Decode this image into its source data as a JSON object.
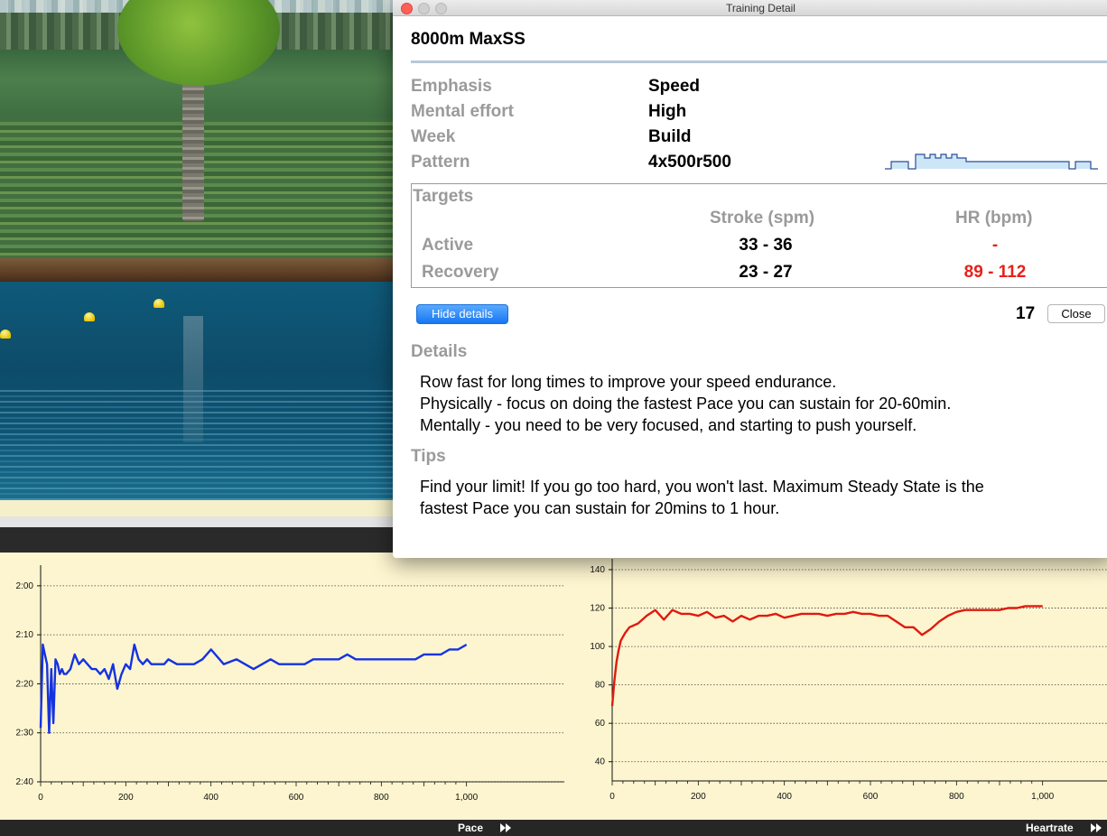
{
  "window": {
    "title": "Training Detail"
  },
  "workout": {
    "name": "8000m MaxSS",
    "info": [
      {
        "label": "Emphasis",
        "value": "Speed"
      },
      {
        "label": "Mental effort",
        "value": "High"
      },
      {
        "label": "Week",
        "value": "Build"
      },
      {
        "label": "Pattern",
        "value": "4x500r500"
      }
    ]
  },
  "targets": {
    "title": "Targets",
    "columns": [
      "Stroke (spm)",
      "HR (bpm)"
    ],
    "rows": [
      {
        "label": "Active",
        "stroke": "33 - 36",
        "hr": "-"
      },
      {
        "label": "Recovery",
        "stroke": "23 - 27",
        "hr": "89 - 112"
      }
    ],
    "hr_color": "#e8201a"
  },
  "controls": {
    "hide_details_label": "Hide details",
    "count": "17",
    "close_label": "Close"
  },
  "details": {
    "heading": "Details",
    "lines": [
      "Row fast for long times to improve your speed endurance.",
      "Physically - focus on doing the fastest Pace you can sustain for 20-60min.",
      "Mentally - you need to be very focused, and starting to push yourself."
    ]
  },
  "tips": {
    "heading": "Tips",
    "lines": [
      "Find your limit!  If you go too hard, you won't last.  Maximum Steady State is the",
      "fastest Pace you can sustain for 20mins to 1 hour."
    ]
  },
  "bottom_bar": {
    "pace_label": "Pace",
    "heartrate_label": "Heartrate"
  },
  "chart_data": [
    {
      "type": "line",
      "name": "Pace",
      "color": "#1433e0",
      "ytick_labels": [
        "2:00",
        "2:10",
        "2:20",
        "2:30",
        "2:40"
      ],
      "yticks_seconds": [
        120,
        130,
        140,
        150,
        160
      ],
      "ylim": [
        118,
        160
      ],
      "y_inverted": true,
      "xtick_labels": [
        "0",
        "200",
        "400",
        "600",
        "800",
        "1,000"
      ],
      "xticks": [
        0,
        200,
        400,
        600,
        800,
        1000
      ],
      "xlim": [
        0,
        1200
      ],
      "grid": "horizontal dotted",
      "x": [
        0,
        5,
        10,
        15,
        20,
        25,
        30,
        35,
        40,
        45,
        50,
        55,
        60,
        70,
        80,
        90,
        100,
        110,
        120,
        130,
        140,
        150,
        160,
        170,
        180,
        190,
        200,
        210,
        220,
        230,
        240,
        250,
        260,
        270,
        280,
        290,
        300,
        320,
        340,
        360,
        380,
        400,
        430,
        460,
        480,
        500,
        520,
        540,
        560,
        580,
        600,
        620,
        640,
        660,
        680,
        700,
        720,
        740,
        760,
        780,
        800,
        820,
        840,
        860,
        880,
        900,
        920,
        940,
        960,
        980,
        1000
      ],
      "values": [
        149,
        132,
        134,
        136,
        150,
        137,
        148,
        135,
        136,
        138,
        137,
        138,
        138,
        137,
        134,
        136,
        135,
        136,
        137,
        137,
        138,
        137,
        139,
        136,
        141,
        138,
        136,
        137,
        132,
        135,
        136,
        135,
        136,
        136,
        136,
        136,
        135,
        136,
        136,
        136,
        135,
        133,
        136,
        135,
        136,
        137,
        136,
        135,
        136,
        136,
        136,
        136,
        135,
        135,
        135,
        135,
        134,
        135,
        135,
        135,
        135,
        135,
        135,
        135,
        135,
        134,
        134,
        134,
        133,
        133,
        132
      ]
    },
    {
      "type": "line",
      "name": "Heartrate",
      "color": "#e01a10",
      "ytick_labels": [
        "140",
        "120",
        "100",
        "80",
        "60",
        "40"
      ],
      "yticks": [
        140,
        120,
        100,
        80,
        60,
        40
      ],
      "ylim": [
        30,
        140
      ],
      "xtick_labels": [
        "0",
        "200",
        "400",
        "600",
        "800",
        "1,000"
      ],
      "xticks": [
        0,
        200,
        400,
        600,
        800,
        1000
      ],
      "xlim": [
        0,
        1200
      ],
      "grid": "horizontal dotted",
      "x": [
        0,
        5,
        10,
        15,
        20,
        30,
        40,
        60,
        80,
        100,
        120,
        140,
        160,
        180,
        200,
        220,
        240,
        260,
        280,
        300,
        320,
        340,
        360,
        380,
        400,
        420,
        440,
        460,
        480,
        500,
        520,
        540,
        560,
        580,
        600,
        620,
        640,
        660,
        680,
        700,
        720,
        740,
        760,
        780,
        800,
        820,
        840,
        860,
        880,
        900,
        920,
        940,
        960,
        980,
        1000
      ],
      "values": [
        69,
        82,
        92,
        98,
        103,
        107,
        110,
        112,
        116,
        119,
        114,
        119,
        117,
        117,
        116,
        118,
        115,
        116,
        113,
        116,
        114,
        116,
        116,
        117,
        115,
        116,
        117,
        117,
        117,
        116,
        117,
        117,
        118,
        117,
        117,
        116,
        116,
        113,
        110,
        110,
        106,
        109,
        113,
        116,
        118,
        119,
        119,
        119,
        119,
        119,
        120,
        120,
        121,
        121,
        121
      ]
    }
  ]
}
